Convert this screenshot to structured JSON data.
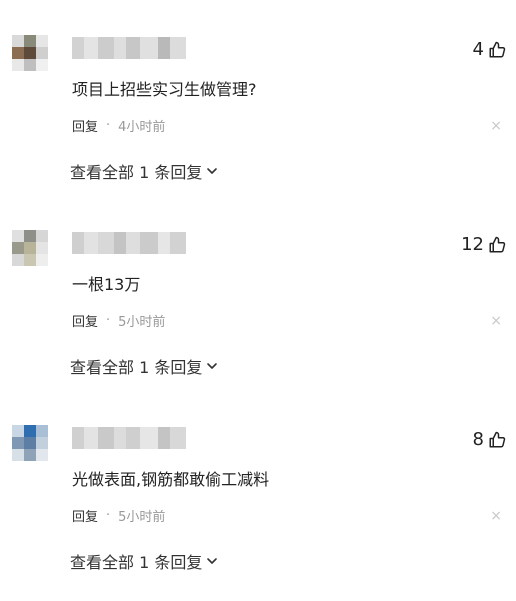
{
  "comments": [
    {
      "likes": "4",
      "text": "项目上招些实习生做管理?",
      "reply_label": "回复",
      "separator": "·",
      "time": "4小时前",
      "view_all_label": "查看全部 1 条回复",
      "avatar_colors": [
        "#d9d9d9",
        "#8a8a7a",
        "#e6e6e6",
        "#8b6d52",
        "#5e4a3a",
        "#cfcfcf",
        "#e8e8e8",
        "#bfbfbf",
        "#f0f0f0"
      ],
      "username_colors": [
        "#d2d2d2",
        "#e4e4e4",
        "#cccccc",
        "#dedede",
        "#c7c7c7",
        "#e0e0e0",
        "#b9b9b9",
        "#dcdcdc"
      ]
    },
    {
      "likes": "12",
      "text": "一根13万",
      "reply_label": "回复",
      "separator": "·",
      "time": "5小时前",
      "view_all_label": "查看全部 1 条回复",
      "avatar_colors": [
        "#e0e0e0",
        "#8f8f8a",
        "#d6d6d6",
        "#9a9a8c",
        "#b8b49a",
        "#e4e4e4",
        "#d8d8d8",
        "#c9c7b2",
        "#eeeeee"
      ],
      "username_colors": [
        "#cfcfcf",
        "#e2e2e2",
        "#d8d8d8",
        "#c4c4c4",
        "#dedede",
        "#cbcbcb",
        "#e6e6e6",
        "#d2d2d2"
      ]
    },
    {
      "likes": "8",
      "text": "光做表面,钢筋都敢偷工减料",
      "reply_label": "回复",
      "separator": "·",
      "time": "5小时前",
      "view_all_label": "查看全部 1 条回复",
      "avatar_colors": [
        "#c9d6e3",
        "#2f6fb0",
        "#a9bfd6",
        "#7f98b4",
        "#5d7fa6",
        "#c2cfdc",
        "#d7dfe7",
        "#8ea2b8",
        "#e1e7ed"
      ],
      "username_colors": [
        "#d0d0d0",
        "#e3e3e3",
        "#c9c9c9",
        "#dcdcdc",
        "#cfcfcf",
        "#e6e6e6",
        "#c4c4c4",
        "#d8d8d8"
      ]
    }
  ],
  "close_glyph": "×",
  "icons": {
    "like": "thumbs-up-icon",
    "chevron": "chevron-down-icon",
    "close": "close-icon"
  }
}
